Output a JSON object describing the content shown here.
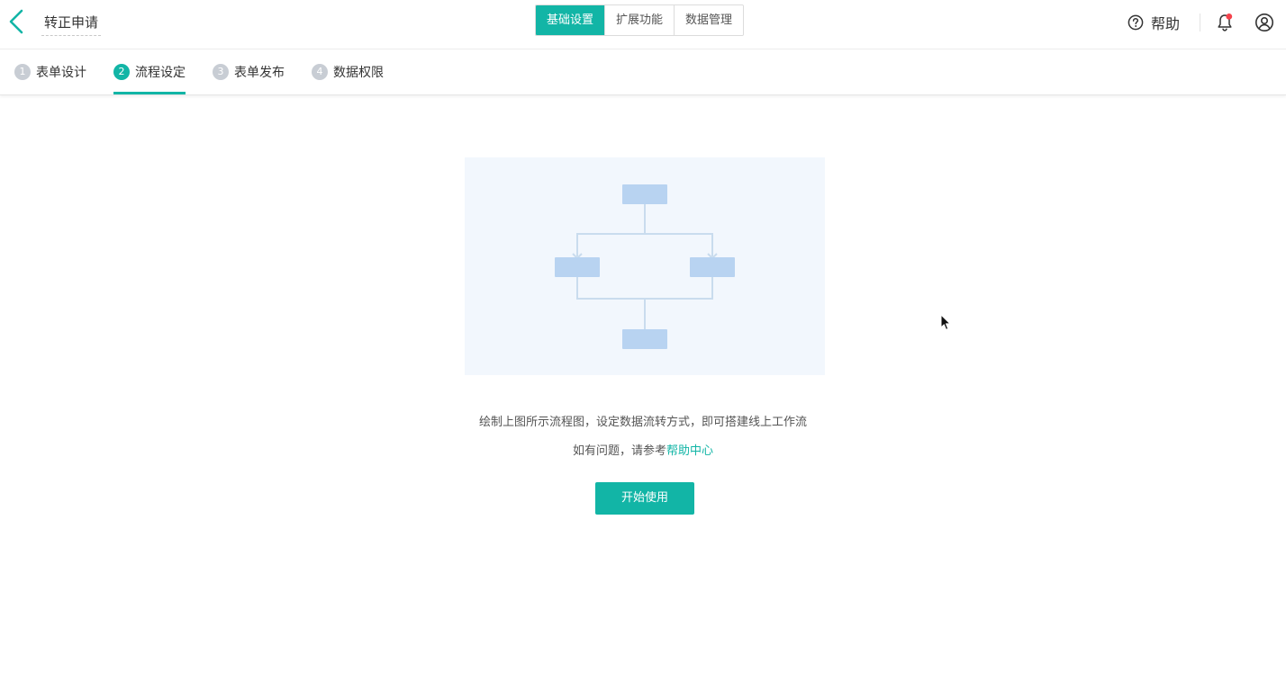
{
  "header": {
    "title": "转正申请",
    "mode_tabs": [
      {
        "label": "基础设置",
        "active": true
      },
      {
        "label": "扩展功能",
        "active": false
      },
      {
        "label": "数据管理",
        "active": false
      }
    ],
    "help_label": "帮助",
    "accent_color": "#12b5a6",
    "notification_dot_color": "#f5424c",
    "icons": [
      "chevron-left-icon",
      "question-circle-icon",
      "bell-icon",
      "user-circle-icon"
    ]
  },
  "steps": [
    {
      "number": "1",
      "label": "表单设计",
      "active": false
    },
    {
      "number": "2",
      "label": "流程设定",
      "active": true
    },
    {
      "number": "3",
      "label": "表单发布",
      "active": false
    },
    {
      "number": "4",
      "label": "数据权限",
      "active": false
    }
  ],
  "empty_state": {
    "line1": "绘制上图所示流程图，设定数据流转方式，即可搭建线上工作流",
    "line2_prefix": "如有问题，请参考",
    "line2_link": "帮助中心",
    "start_button": "开始使用"
  }
}
